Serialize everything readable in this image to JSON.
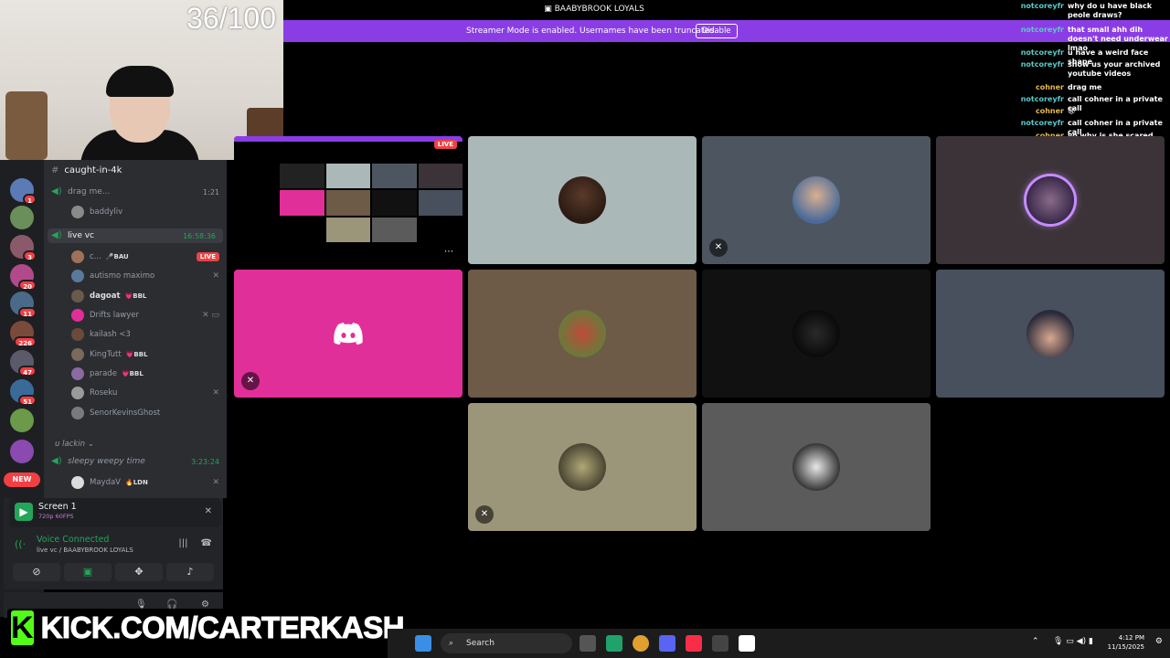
{
  "webcam": {
    "counter": "36/100"
  },
  "top_title": "BAABYBROOK LOYALS",
  "streamer_banner": {
    "text": "Streamer Mode is enabled. Usernames have been truncated.",
    "button": "Disable"
  },
  "chat": [
    {
      "user": "notcoreyfr",
      "color": "#5cc8c8",
      "msg": "why do u have black peole draws?"
    },
    {
      "user": "notcoreyfr",
      "color": "#5cc8c8",
      "msg": "that small ahh dih doesn't need underwear lmao"
    },
    {
      "user": "notcoreyfr",
      "color": "#5cc8c8",
      "msg": "u have a weird face shape"
    },
    {
      "user": "notcoreyfr",
      "color": "#5cc8c8",
      "msg": "show us your archived youtube videos"
    },
    {
      "user": "cohner",
      "color": "#e6b84a",
      "msg": "drag me"
    },
    {
      "user": "notcoreyfr",
      "color": "#5cc8c8",
      "msg": "call cohner in a private call"
    },
    {
      "user": "cohner",
      "color": "#e6b84a",
      "msg": "😩"
    },
    {
      "user": "notcoreyfr",
      "color": "#5cc8c8",
      "msg": "call cohner in a private call"
    },
    {
      "user": "cohner",
      "color": "#e6b84a",
      "msg": "yo why is she scared"
    }
  ],
  "sidebar": {
    "channel_header": "caught-in-4k",
    "drag_me": {
      "label": "drag me...",
      "time": "1:21",
      "user": "baddyliv"
    },
    "live_vc": {
      "label": "live vc",
      "time": "16:58:36"
    },
    "live_vc_users": [
      {
        "name": "c...",
        "tag": "🎤BAU",
        "live": "LIVE"
      },
      {
        "name": "autismo maximo",
        "tag": ""
      },
      {
        "name": "dagoat",
        "tag": "💗BBL"
      },
      {
        "name": "Drifts lawyer",
        "tag": ""
      },
      {
        "name": "kailash <3",
        "tag": ""
      },
      {
        "name": "KingTutt",
        "tag": "💗BBL"
      },
      {
        "name": "parade",
        "tag": "💗BBL"
      },
      {
        "name": "Roseku",
        "tag": ""
      },
      {
        "name": "SenorKevinsGhost",
        "tag": ""
      }
    ],
    "category": "u lackin",
    "sleepy": {
      "label": "sleepy weepy time",
      "time": "3:23:24",
      "user": "MaydaV",
      "tag": "🔥LDN"
    }
  },
  "rail": {
    "badges": [
      "1",
      "3",
      "20",
      "11",
      "226",
      "47",
      "51"
    ],
    "new_label": "NEW"
  },
  "panel": {
    "screen_title": "Screen 1",
    "screen_sub": "720p 60FPS",
    "voice_status": "Voice Connected",
    "voice_channel": "live vc / BAABYBROOK LOYALS"
  },
  "kick": {
    "text": "KICK.COM/CARTERKASH",
    "logo_letter": "K"
  },
  "grid": {
    "live_label": "LIVE",
    "tile_colors": [
      "#000000",
      "#abb8b8",
      "#4d5660",
      "#3b3338",
      "#e12f99",
      "#6d5a47",
      "#111111",
      "#47505c",
      "#9b9679",
      "#5b5b5b"
    ]
  },
  "taskbar": {
    "search_label": "Search",
    "time": "4:12 PM",
    "date": "11/15/2025"
  },
  "colors": {
    "accent_green": "#23a55a",
    "streamer_purple": "#8b3de5",
    "kick_green": "#53fc18",
    "live_red": "#ed4245"
  }
}
